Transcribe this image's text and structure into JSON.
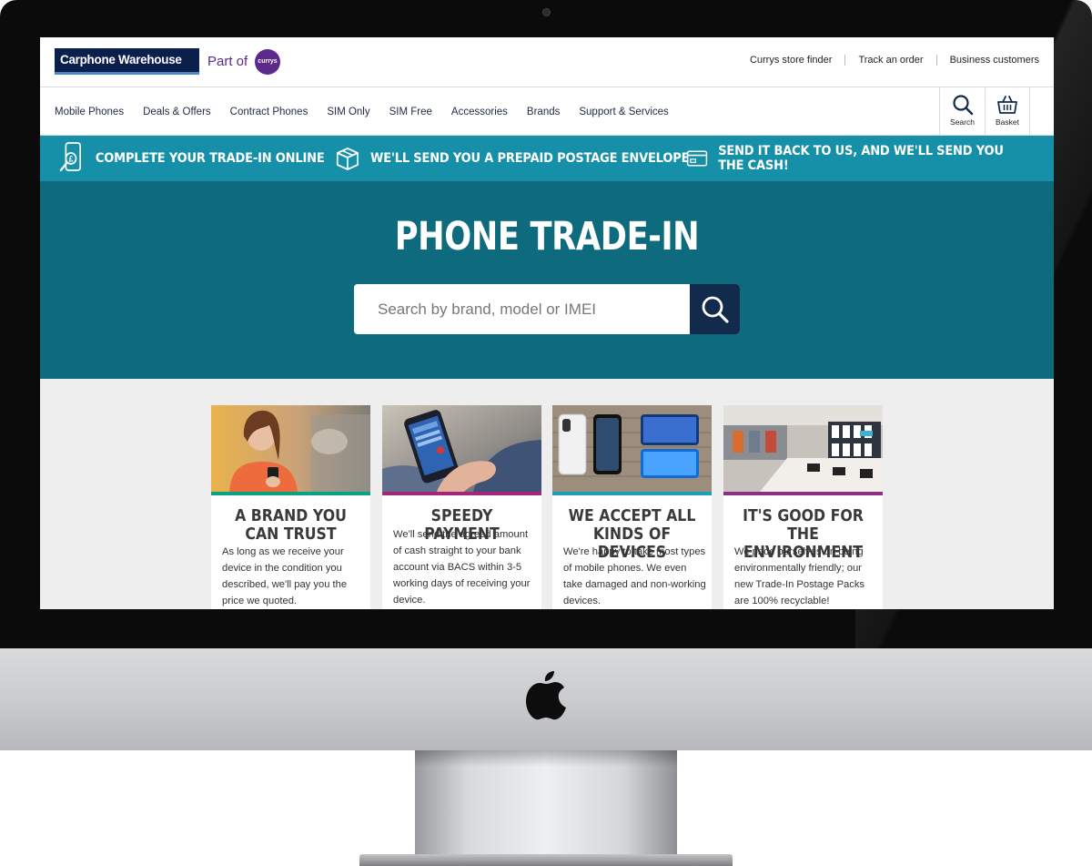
{
  "header": {
    "brand": "Carphone Warehouse",
    "part_of": "Part of",
    "currys": "currys",
    "links": [
      "Currys store finder",
      "Track an order",
      "Business customers"
    ]
  },
  "nav": {
    "items": [
      "Mobile Phones",
      "Deals & Offers",
      "Contract Phones",
      "SIM Only",
      "SIM Free",
      "Accessories",
      "Brands",
      "Support & Services"
    ],
    "search_label": "Search",
    "basket_label": "Basket"
  },
  "steps": [
    "COMPLETE YOUR TRADE-IN ONLINE",
    "WE'LL SEND YOU A PREPAID POSTAGE ENVELOPE",
    "SEND IT BACK TO US, AND WE'LL SEND YOU THE CASH!"
  ],
  "hero": {
    "title": "PHONE TRADE-IN",
    "search_placeholder": "Search by brand, model or IMEI"
  },
  "cards": [
    {
      "title": "A BRAND YOU CAN TRUST",
      "body": "As long as we receive your device in the condition you described, we'll pay you the price we quoted.",
      "accent": "#0aa37f"
    },
    {
      "title": "SPEEDY PAYMENT",
      "body": "We'll send the agreed amount of cash straight to your bank account via BACS within 3-5 working days of receiving your device.",
      "accent": "#a3267a"
    },
    {
      "title": "WE ACCEPT ALL KINDS OF DEVICES",
      "body": "We're happy to take most types of mobile phones. We even take damaged and non-working devices.",
      "accent": "#1e9fb8"
    },
    {
      "title": "IT'S GOOD FOR THE ENVIRONMENT",
      "body": "We pride ourselves on being environmentally friendly; our new Trade-In Postage Packs are 100% recyclable!",
      "accent": "#8e2f86"
    }
  ],
  "colors": {
    "steps_bg": "#1690a9",
    "hero_bg": "#0e6b7d",
    "search_button": "#122a4b",
    "brand_navy": "#0b1f4d",
    "currys_purple": "#5b2a8c"
  }
}
